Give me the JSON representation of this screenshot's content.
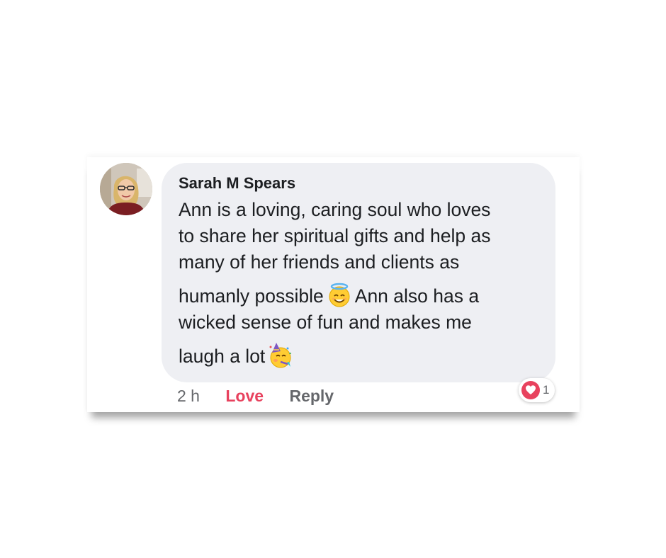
{
  "comment": {
    "author": "Sarah M Spears",
    "lines": [
      "Ann is a loving, caring soul who loves",
      "to share her spiritual gifts and help as",
      "many of her friends and clients as",
      "humanly possible",
      "Ann also has a",
      "wicked sense of fun and makes me",
      "laugh a lot"
    ],
    "emojis": [
      "smiling-face-with-halo",
      "partying-face"
    ]
  },
  "actions": {
    "time": "2 h",
    "love": "Love",
    "reply": "Reply"
  },
  "reaction": {
    "icon": "heart-icon",
    "count": "1",
    "color": "#e8425e"
  },
  "colors": {
    "bubble": "#eeeff3",
    "text": "#1c1e21",
    "muted": "#65676b",
    "love": "#e8425e"
  }
}
